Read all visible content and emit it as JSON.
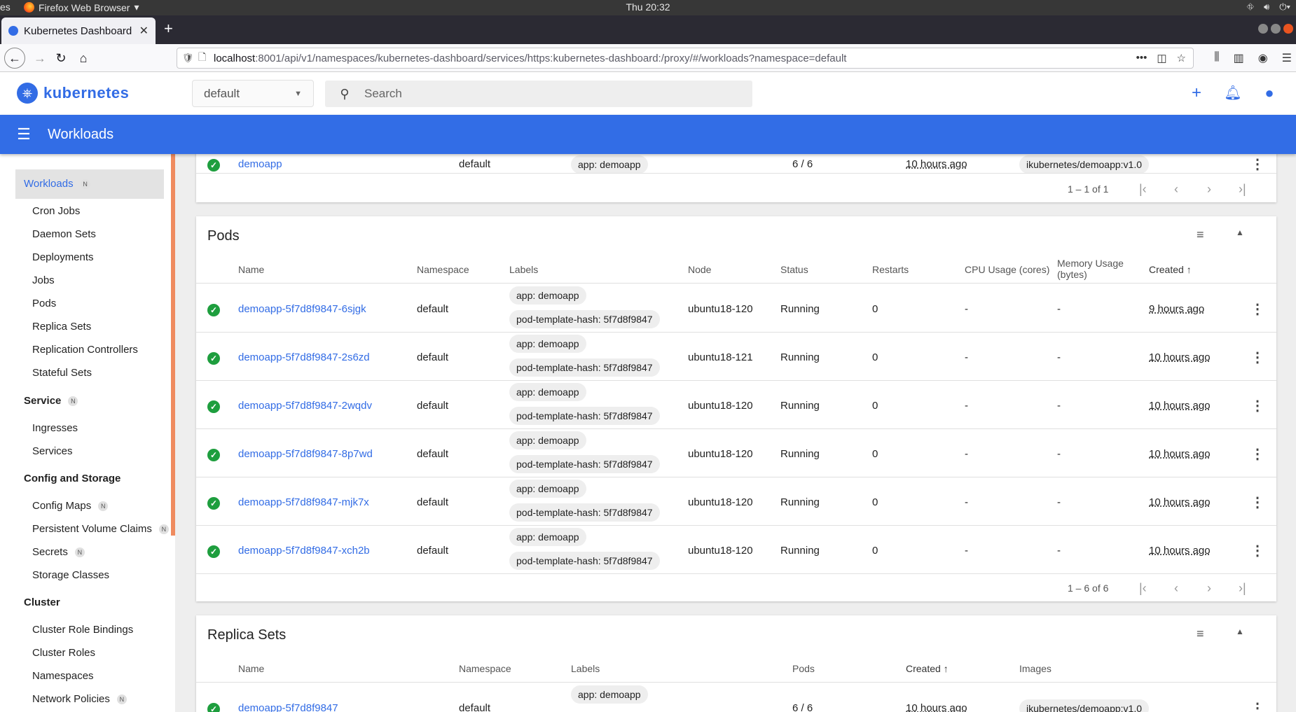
{
  "os": {
    "activities": "es",
    "app": "Firefox Web Browser",
    "clock": "Thu 20:32"
  },
  "browser": {
    "tab_title": "Kubernetes Dashboard",
    "url_host": "localhost",
    "url_rest": ":8001/api/v1/namespaces/kubernetes-dashboard/services/https:kubernetes-dashboard:/proxy/#/workloads?namespace=default"
  },
  "header": {
    "brand": "kubernetes",
    "namespace": "default",
    "search_placeholder": "Search"
  },
  "titlebar": {
    "title": "Workloads"
  },
  "sidebar": {
    "workloads": "Workloads",
    "workloads_badge": "N",
    "wl_items": [
      "Cron Jobs",
      "Daemon Sets",
      "Deployments",
      "Jobs",
      "Pods",
      "Replica Sets",
      "Replication Controllers",
      "Stateful Sets"
    ],
    "service": "Service",
    "service_badge": "N",
    "svc_items": [
      "Ingresses",
      "Services"
    ],
    "config": "Config and Storage",
    "cfg_items": [
      "Config Maps",
      "Persistent Volume Claims",
      "Secrets",
      "Storage Classes"
    ],
    "cfg_badges": [
      "N",
      "N",
      "N",
      ""
    ],
    "cluster": "Cluster",
    "cluster_items": [
      "Cluster Role Bindings",
      "Cluster Roles",
      "Namespaces",
      "Network Policies"
    ],
    "cluster_badges": [
      "",
      "",
      "",
      "N"
    ]
  },
  "deploy": {
    "name": "demoapp",
    "namespace": "default",
    "label": "app: demoapp",
    "pods": "6 / 6",
    "created": "10 hours ago",
    "image": "ikubernetes/demoapp:v1.0",
    "pager": "1 – 1 of 1"
  },
  "pods": {
    "title": "Pods",
    "headers": {
      "name": "Name",
      "namespace": "Namespace",
      "labels": "Labels",
      "node": "Node",
      "status": "Status",
      "restarts": "Restarts",
      "cpu": "CPU Usage (cores)",
      "mem1": "Memory Usage",
      "mem2": "(bytes)",
      "created": "Created ↑"
    },
    "rows": [
      {
        "name": "demoapp-5f7d8f9847-6sjgk",
        "namespace": "default",
        "l1": "app: demoapp",
        "l2": "pod-template-hash: 5f7d8f9847",
        "node": "ubuntu18-120",
        "status": "Running",
        "restarts": "0",
        "cpu": "-",
        "mem": "-",
        "created": "9 hours ago"
      },
      {
        "name": "demoapp-5f7d8f9847-2s6zd",
        "namespace": "default",
        "l1": "app: demoapp",
        "l2": "pod-template-hash: 5f7d8f9847",
        "node": "ubuntu18-121",
        "status": "Running",
        "restarts": "0",
        "cpu": "-",
        "mem": "-",
        "created": "10 hours ago"
      },
      {
        "name": "demoapp-5f7d8f9847-2wqdv",
        "namespace": "default",
        "l1": "app: demoapp",
        "l2": "pod-template-hash: 5f7d8f9847",
        "node": "ubuntu18-120",
        "status": "Running",
        "restarts": "0",
        "cpu": "-",
        "mem": "-",
        "created": "10 hours ago"
      },
      {
        "name": "demoapp-5f7d8f9847-8p7wd",
        "namespace": "default",
        "l1": "app: demoapp",
        "l2": "pod-template-hash: 5f7d8f9847",
        "node": "ubuntu18-120",
        "status": "Running",
        "restarts": "0",
        "cpu": "-",
        "mem": "-",
        "created": "10 hours ago"
      },
      {
        "name": "demoapp-5f7d8f9847-mjk7x",
        "namespace": "default",
        "l1": "app: demoapp",
        "l2": "pod-template-hash: 5f7d8f9847",
        "node": "ubuntu18-120",
        "status": "Running",
        "restarts": "0",
        "cpu": "-",
        "mem": "-",
        "created": "10 hours ago"
      },
      {
        "name": "demoapp-5f7d8f9847-xch2b",
        "namespace": "default",
        "l1": "app: demoapp",
        "l2": "pod-template-hash: 5f7d8f9847",
        "node": "ubuntu18-120",
        "status": "Running",
        "restarts": "0",
        "cpu": "-",
        "mem": "-",
        "created": "10 hours ago"
      }
    ],
    "pager": "1 – 6 of 6"
  },
  "rs": {
    "title": "Replica Sets",
    "headers": {
      "name": "Name",
      "namespace": "Namespace",
      "labels": "Labels",
      "pods": "Pods",
      "created": "Created ↑",
      "images": "Images"
    },
    "row": {
      "name": "demoapp-5f7d8f9847",
      "namespace": "default",
      "label": "app: demoapp",
      "pods": "6 / 6",
      "created": "10 hours ago",
      "image": "ikubernetes/demoapp:v1.0"
    }
  }
}
